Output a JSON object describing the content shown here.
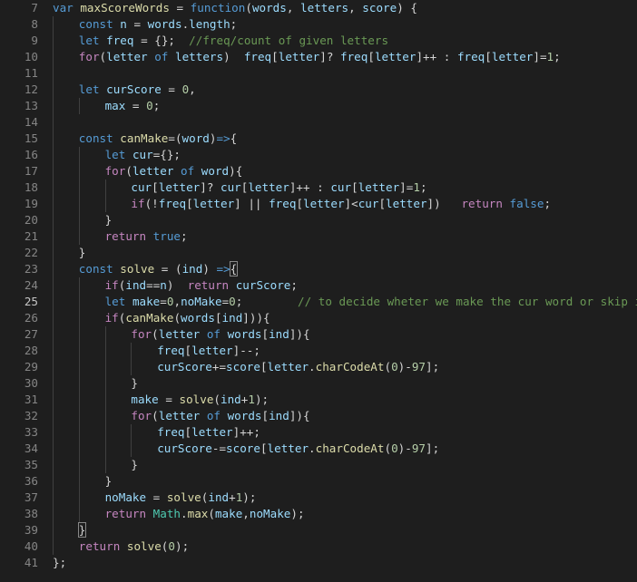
{
  "editor": {
    "theme_colors": {
      "background": "#1e1e1e",
      "line_number": "#858585",
      "keyword": "#569cd6",
      "control": "#c586c0",
      "variable": "#9cdcfe",
      "function": "#dcdcaa",
      "number": "#b5cea8",
      "comment": "#6a9955",
      "type": "#4ec9b0"
    },
    "current_line": 25,
    "lines": [
      {
        "n": "7",
        "indent": 0,
        "tokens": [
          {
            "t": "var ",
            "c": "kw"
          },
          {
            "t": "maxScoreWords",
            "c": "fn"
          },
          {
            "t": " = ",
            "c": "op"
          },
          {
            "t": "function",
            "c": "kw"
          },
          {
            "t": "(",
            "c": "op"
          },
          {
            "t": "words",
            "c": "var"
          },
          {
            "t": ", ",
            "c": "op"
          },
          {
            "t": "letters",
            "c": "var"
          },
          {
            "t": ", ",
            "c": "op"
          },
          {
            "t": "score",
            "c": "var"
          },
          {
            "t": ") {",
            "c": "op"
          }
        ]
      },
      {
        "n": "8",
        "indent": 1,
        "tokens": [
          {
            "t": "const ",
            "c": "kw"
          },
          {
            "t": "n",
            "c": "var"
          },
          {
            "t": " = ",
            "c": "op"
          },
          {
            "t": "words",
            "c": "var"
          },
          {
            "t": ".",
            "c": "op"
          },
          {
            "t": "length",
            "c": "var"
          },
          {
            "t": ";",
            "c": "op"
          }
        ]
      },
      {
        "n": "9",
        "indent": 1,
        "tokens": [
          {
            "t": "let ",
            "c": "kw"
          },
          {
            "t": "freq",
            "c": "var"
          },
          {
            "t": " = {};  ",
            "c": "op"
          },
          {
            "t": "//freq/count of given letters",
            "c": "cmt"
          }
        ]
      },
      {
        "n": "10",
        "indent": 1,
        "tokens": [
          {
            "t": "for",
            "c": "ctrl"
          },
          {
            "t": "(",
            "c": "op"
          },
          {
            "t": "letter",
            "c": "var"
          },
          {
            "t": " of ",
            "c": "kw"
          },
          {
            "t": "letters",
            "c": "var"
          },
          {
            "t": ")  ",
            "c": "op"
          },
          {
            "t": "freq",
            "c": "var"
          },
          {
            "t": "[",
            "c": "op"
          },
          {
            "t": "letter",
            "c": "var"
          },
          {
            "t": "]? ",
            "c": "op"
          },
          {
            "t": "freq",
            "c": "var"
          },
          {
            "t": "[",
            "c": "op"
          },
          {
            "t": "letter",
            "c": "var"
          },
          {
            "t": "]++ : ",
            "c": "op"
          },
          {
            "t": "freq",
            "c": "var"
          },
          {
            "t": "[",
            "c": "op"
          },
          {
            "t": "letter",
            "c": "var"
          },
          {
            "t": "]=",
            "c": "op"
          },
          {
            "t": "1",
            "c": "num"
          },
          {
            "t": ";",
            "c": "op"
          }
        ]
      },
      {
        "n": "11",
        "indent": 1,
        "tokens": []
      },
      {
        "n": "12",
        "indent": 1,
        "tokens": [
          {
            "t": "let ",
            "c": "kw"
          },
          {
            "t": "curScore",
            "c": "var"
          },
          {
            "t": " = ",
            "c": "op"
          },
          {
            "t": "0",
            "c": "num"
          },
          {
            "t": ",",
            "c": "op"
          }
        ]
      },
      {
        "n": "13",
        "indent": 2,
        "tokens": [
          {
            "t": "max",
            "c": "var"
          },
          {
            "t": " = ",
            "c": "op"
          },
          {
            "t": "0",
            "c": "num"
          },
          {
            "t": ";",
            "c": "op"
          }
        ]
      },
      {
        "n": "14",
        "indent": 1,
        "tokens": []
      },
      {
        "n": "15",
        "indent": 1,
        "tokens": [
          {
            "t": "const ",
            "c": "kw"
          },
          {
            "t": "canMake",
            "c": "fn"
          },
          {
            "t": "=(",
            "c": "op"
          },
          {
            "t": "word",
            "c": "var"
          },
          {
            "t": ")",
            "c": "op"
          },
          {
            "t": "=>",
            "c": "kw"
          },
          {
            "t": "{",
            "c": "op"
          }
        ]
      },
      {
        "n": "16",
        "indent": 2,
        "tokens": [
          {
            "t": "let ",
            "c": "kw"
          },
          {
            "t": "cur",
            "c": "var"
          },
          {
            "t": "={};",
            "c": "op"
          }
        ]
      },
      {
        "n": "17",
        "indent": 2,
        "tokens": [
          {
            "t": "for",
            "c": "ctrl"
          },
          {
            "t": "(",
            "c": "op"
          },
          {
            "t": "letter",
            "c": "var"
          },
          {
            "t": " of ",
            "c": "kw"
          },
          {
            "t": "word",
            "c": "var"
          },
          {
            "t": "){",
            "c": "op"
          }
        ]
      },
      {
        "n": "18",
        "indent": 3,
        "tokens": [
          {
            "t": "cur",
            "c": "var"
          },
          {
            "t": "[",
            "c": "op"
          },
          {
            "t": "letter",
            "c": "var"
          },
          {
            "t": "]? ",
            "c": "op"
          },
          {
            "t": "cur",
            "c": "var"
          },
          {
            "t": "[",
            "c": "op"
          },
          {
            "t": "letter",
            "c": "var"
          },
          {
            "t": "]++ : ",
            "c": "op"
          },
          {
            "t": "cur",
            "c": "var"
          },
          {
            "t": "[",
            "c": "op"
          },
          {
            "t": "letter",
            "c": "var"
          },
          {
            "t": "]=",
            "c": "op"
          },
          {
            "t": "1",
            "c": "num"
          },
          {
            "t": ";",
            "c": "op"
          }
        ]
      },
      {
        "n": "19",
        "indent": 3,
        "tokens": [
          {
            "t": "if",
            "c": "ctrl"
          },
          {
            "t": "(!",
            "c": "op"
          },
          {
            "t": "freq",
            "c": "var"
          },
          {
            "t": "[",
            "c": "op"
          },
          {
            "t": "letter",
            "c": "var"
          },
          {
            "t": "] || ",
            "c": "op"
          },
          {
            "t": "freq",
            "c": "var"
          },
          {
            "t": "[",
            "c": "op"
          },
          {
            "t": "letter",
            "c": "var"
          },
          {
            "t": "]<",
            "c": "op"
          },
          {
            "t": "cur",
            "c": "var"
          },
          {
            "t": "[",
            "c": "op"
          },
          {
            "t": "letter",
            "c": "var"
          },
          {
            "t": "])   ",
            "c": "op"
          },
          {
            "t": "return ",
            "c": "ctrl"
          },
          {
            "t": "false",
            "c": "kw"
          },
          {
            "t": ";",
            "c": "op"
          }
        ]
      },
      {
        "n": "20",
        "indent": 2,
        "tokens": [
          {
            "t": "}",
            "c": "op"
          }
        ]
      },
      {
        "n": "21",
        "indent": 2,
        "tokens": [
          {
            "t": "return ",
            "c": "ctrl"
          },
          {
            "t": "true",
            "c": "kw"
          },
          {
            "t": ";",
            "c": "op"
          }
        ]
      },
      {
        "n": "22",
        "indent": 1,
        "tokens": [
          {
            "t": "}",
            "c": "op"
          }
        ]
      },
      {
        "n": "23",
        "indent": 1,
        "tokens": [
          {
            "t": "const ",
            "c": "kw"
          },
          {
            "t": "solve",
            "c": "fn"
          },
          {
            "t": " = (",
            "c": "op"
          },
          {
            "t": "ind",
            "c": "var"
          },
          {
            "t": ") ",
            "c": "op"
          },
          {
            "t": "=>",
            "c": "kw"
          },
          {
            "t": "{",
            "c": "op",
            "match": true
          }
        ]
      },
      {
        "n": "24",
        "indent": 2,
        "tokens": [
          {
            "t": "if",
            "c": "ctrl"
          },
          {
            "t": "(",
            "c": "op"
          },
          {
            "t": "ind",
            "c": "var"
          },
          {
            "t": "==",
            "c": "op"
          },
          {
            "t": "n",
            "c": "var"
          },
          {
            "t": ")  ",
            "c": "op"
          },
          {
            "t": "return ",
            "c": "ctrl"
          },
          {
            "t": "curScore",
            "c": "var"
          },
          {
            "t": ";",
            "c": "op"
          }
        ]
      },
      {
        "n": "25",
        "indent": 2,
        "tokens": [
          {
            "t": "let ",
            "c": "kw"
          },
          {
            "t": "make",
            "c": "var"
          },
          {
            "t": "=",
            "c": "op"
          },
          {
            "t": "0",
            "c": "num"
          },
          {
            "t": ",",
            "c": "op"
          },
          {
            "t": "noMake",
            "c": "var"
          },
          {
            "t": "=",
            "c": "op"
          },
          {
            "t": "0",
            "c": "num"
          },
          {
            "t": ";        ",
            "c": "op"
          },
          {
            "t": "// to decide wheter we make the cur word or skip it.",
            "c": "cmt"
          }
        ]
      },
      {
        "n": "26",
        "indent": 2,
        "tokens": [
          {
            "t": "if",
            "c": "ctrl"
          },
          {
            "t": "(",
            "c": "op"
          },
          {
            "t": "canMake",
            "c": "fn"
          },
          {
            "t": "(",
            "c": "op"
          },
          {
            "t": "words",
            "c": "var"
          },
          {
            "t": "[",
            "c": "op"
          },
          {
            "t": "ind",
            "c": "var"
          },
          {
            "t": "])){",
            "c": "op"
          }
        ]
      },
      {
        "n": "27",
        "indent": 3,
        "tokens": [
          {
            "t": "for",
            "c": "ctrl"
          },
          {
            "t": "(",
            "c": "op"
          },
          {
            "t": "letter",
            "c": "var"
          },
          {
            "t": " of ",
            "c": "kw"
          },
          {
            "t": "words",
            "c": "var"
          },
          {
            "t": "[",
            "c": "op"
          },
          {
            "t": "ind",
            "c": "var"
          },
          {
            "t": "]){",
            "c": "op"
          }
        ]
      },
      {
        "n": "28",
        "indent": 4,
        "tokens": [
          {
            "t": "freq",
            "c": "var"
          },
          {
            "t": "[",
            "c": "op"
          },
          {
            "t": "letter",
            "c": "var"
          },
          {
            "t": "]--;",
            "c": "op"
          }
        ]
      },
      {
        "n": "29",
        "indent": 4,
        "tokens": [
          {
            "t": "curScore",
            "c": "var"
          },
          {
            "t": "+=",
            "c": "op"
          },
          {
            "t": "score",
            "c": "var"
          },
          {
            "t": "[",
            "c": "op"
          },
          {
            "t": "letter",
            "c": "var"
          },
          {
            "t": ".",
            "c": "op"
          },
          {
            "t": "charCodeAt",
            "c": "fn"
          },
          {
            "t": "(",
            "c": "op"
          },
          {
            "t": "0",
            "c": "num"
          },
          {
            "t": ")-",
            "c": "op"
          },
          {
            "t": "97",
            "c": "num"
          },
          {
            "t": "];",
            "c": "op"
          }
        ]
      },
      {
        "n": "30",
        "indent": 3,
        "tokens": [
          {
            "t": "}",
            "c": "op"
          }
        ]
      },
      {
        "n": "31",
        "indent": 3,
        "tokens": [
          {
            "t": "make",
            "c": "var"
          },
          {
            "t": " = ",
            "c": "op"
          },
          {
            "t": "solve",
            "c": "fn"
          },
          {
            "t": "(",
            "c": "op"
          },
          {
            "t": "ind",
            "c": "var"
          },
          {
            "t": "+",
            "c": "op"
          },
          {
            "t": "1",
            "c": "num"
          },
          {
            "t": ");",
            "c": "op"
          }
        ]
      },
      {
        "n": "32",
        "indent": 3,
        "tokens": [
          {
            "t": "for",
            "c": "ctrl"
          },
          {
            "t": "(",
            "c": "op"
          },
          {
            "t": "letter",
            "c": "var"
          },
          {
            "t": " of ",
            "c": "kw"
          },
          {
            "t": "words",
            "c": "var"
          },
          {
            "t": "[",
            "c": "op"
          },
          {
            "t": "ind",
            "c": "var"
          },
          {
            "t": "]){",
            "c": "op"
          }
        ]
      },
      {
        "n": "33",
        "indent": 4,
        "tokens": [
          {
            "t": "freq",
            "c": "var"
          },
          {
            "t": "[",
            "c": "op"
          },
          {
            "t": "letter",
            "c": "var"
          },
          {
            "t": "]++;",
            "c": "op"
          }
        ]
      },
      {
        "n": "34",
        "indent": 4,
        "tokens": [
          {
            "t": "curScore",
            "c": "var"
          },
          {
            "t": "-=",
            "c": "op"
          },
          {
            "t": "score",
            "c": "var"
          },
          {
            "t": "[",
            "c": "op"
          },
          {
            "t": "letter",
            "c": "var"
          },
          {
            "t": ".",
            "c": "op"
          },
          {
            "t": "charCodeAt",
            "c": "fn"
          },
          {
            "t": "(",
            "c": "op"
          },
          {
            "t": "0",
            "c": "num"
          },
          {
            "t": ")-",
            "c": "op"
          },
          {
            "t": "97",
            "c": "num"
          },
          {
            "t": "];",
            "c": "op"
          }
        ]
      },
      {
        "n": "35",
        "indent": 3,
        "tokens": [
          {
            "t": "}",
            "c": "op"
          }
        ]
      },
      {
        "n": "36",
        "indent": 2,
        "tokens": [
          {
            "t": "}",
            "c": "op"
          }
        ]
      },
      {
        "n": "37",
        "indent": 2,
        "tokens": [
          {
            "t": "noMake",
            "c": "var"
          },
          {
            "t": " = ",
            "c": "op"
          },
          {
            "t": "solve",
            "c": "fn"
          },
          {
            "t": "(",
            "c": "op"
          },
          {
            "t": "ind",
            "c": "var"
          },
          {
            "t": "+",
            "c": "op"
          },
          {
            "t": "1",
            "c": "num"
          },
          {
            "t": ");",
            "c": "op"
          }
        ]
      },
      {
        "n": "38",
        "indent": 2,
        "tokens": [
          {
            "t": "return ",
            "c": "ctrl"
          },
          {
            "t": "Math",
            "c": "type"
          },
          {
            "t": ".",
            "c": "op"
          },
          {
            "t": "max",
            "c": "fn"
          },
          {
            "t": "(",
            "c": "op"
          },
          {
            "t": "make",
            "c": "var"
          },
          {
            "t": ",",
            "c": "op"
          },
          {
            "t": "noMake",
            "c": "var"
          },
          {
            "t": ");",
            "c": "op"
          }
        ]
      },
      {
        "n": "39",
        "indent": 1,
        "tokens": [
          {
            "t": "}",
            "c": "op",
            "match": true
          }
        ]
      },
      {
        "n": "40",
        "indent": 1,
        "tokens": [
          {
            "t": "return ",
            "c": "ctrl"
          },
          {
            "t": "solve",
            "c": "fn"
          },
          {
            "t": "(",
            "c": "op"
          },
          {
            "t": "0",
            "c": "num"
          },
          {
            "t": ");",
            "c": "op"
          }
        ]
      },
      {
        "n": "41",
        "indent": 0,
        "tokens": [
          {
            "t": "};",
            "c": "op"
          }
        ]
      }
    ]
  }
}
